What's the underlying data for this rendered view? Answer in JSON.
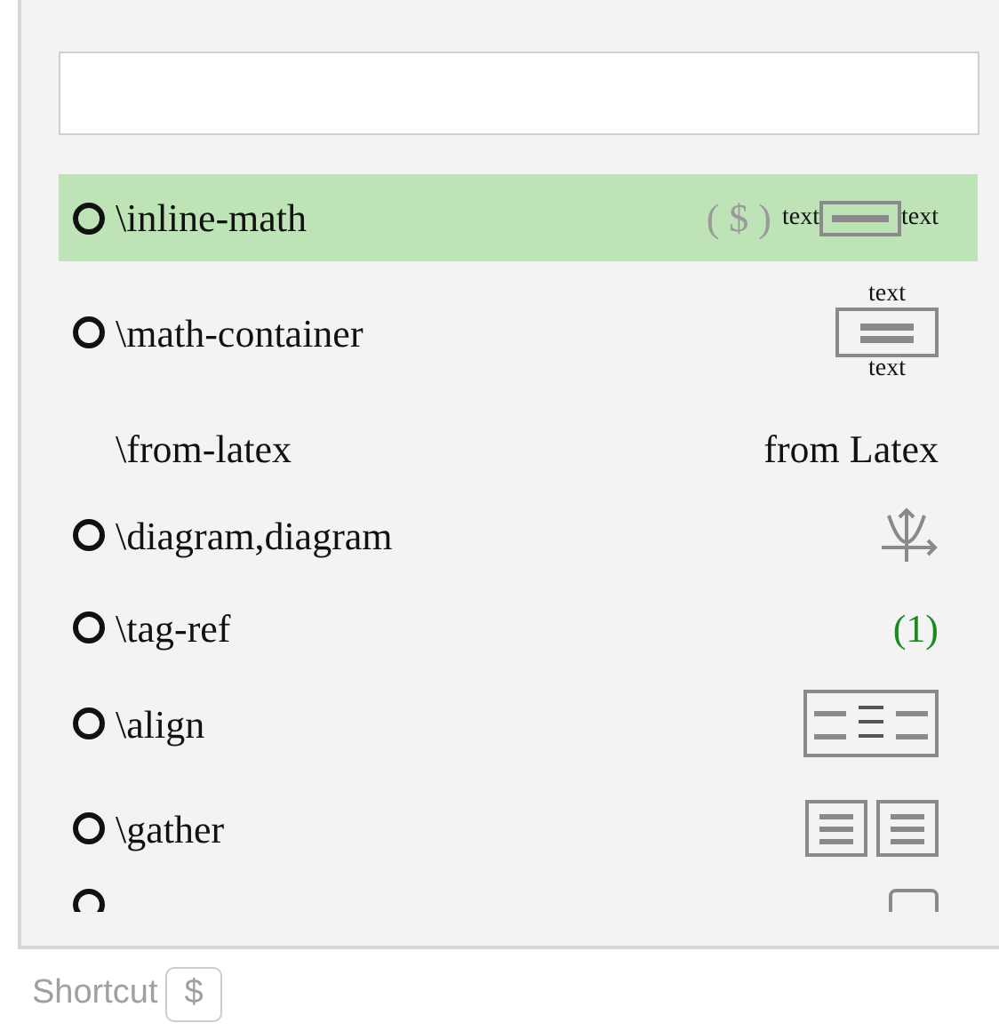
{
  "items": [
    {
      "command": "\\inline-math",
      "bullet": true,
      "selected": true,
      "preview": {
        "kind": "inline",
        "dollar": "( $ )",
        "before": "text",
        "after": "text"
      }
    },
    {
      "command": "\\math-container",
      "bullet": true,
      "selected": false,
      "preview": {
        "kind": "container",
        "above": "text",
        "below": "text"
      }
    },
    {
      "command": "\\from-latex",
      "bullet": false,
      "selected": false,
      "preview": {
        "kind": "label",
        "text": "from Latex"
      }
    },
    {
      "command": "\\diagram,diagram",
      "bullet": true,
      "selected": false,
      "preview": {
        "kind": "diagram"
      }
    },
    {
      "command": "\\tag-ref",
      "bullet": true,
      "selected": false,
      "preview": {
        "kind": "tag",
        "text": "(1)"
      }
    },
    {
      "command": "\\align",
      "bullet": true,
      "selected": false,
      "preview": {
        "kind": "align"
      }
    },
    {
      "command": "\\gather",
      "bullet": true,
      "selected": false,
      "preview": {
        "kind": "gather"
      }
    },
    {
      "bullet": true,
      "selected": false,
      "preview": {
        "kind": "box"
      }
    }
  ],
  "footer": {
    "label": "Shortcut",
    "key": "$"
  }
}
